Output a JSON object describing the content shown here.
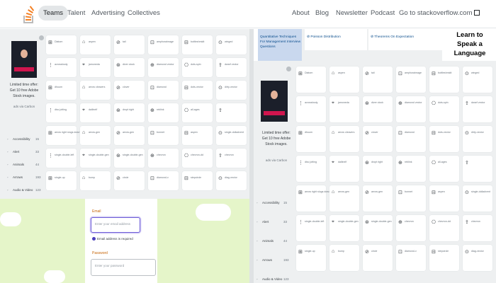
{
  "topbar": {
    "logo": "stackoverflow-logo",
    "nav": [
      "Teams",
      "Talent",
      "Advertising",
      "Collectives"
    ],
    "right_links": [
      "About",
      "Blog",
      "Newsletter",
      "Podcast",
      "Go to stackoverflow.com"
    ]
  },
  "blog": {
    "titles": [
      "Quantitative Techniques For Management Interview Questions",
      "Poisson Distribution",
      "Theorems On Expectation"
    ],
    "ad_big": "Learn to Speak a Language"
  },
  "ad": {
    "headline": "Limited time offer: Get 10 free Adobe Stock images.",
    "author": "ads via Carbon"
  },
  "categories": [
    {
      "label": "Accessibility",
      "count": "15"
    },
    {
      "label": "Alert",
      "count": "33"
    },
    {
      "label": "Animals",
      "count": "44"
    },
    {
      "label": "Arrows",
      "count": "193"
    },
    {
      "label": "Audio & Video",
      "count": "123"
    }
  ],
  "tiles_left": [
    [
      "Diatom",
      "aspen",
      "tail",
      "amphoraimage",
      "bottleshmidt",
      "winged"
    ],
    [
      "acrossbody",
      "jamoneda",
      "diver clock",
      "diamond vector",
      "dots-spin",
      "dwarf vector"
    ],
    [
      "dhuum",
      "arrow cleavers",
      "clover",
      "diamond",
      "dots-vector",
      "dirty-vector"
    ],
    [
      "disc jotting",
      "dailinelf",
      "dropt right",
      "reblink",
      "all-ages",
      ""
    ],
    [
      "arrow right slugs down",
      "arrow-gen",
      "arrow-gen",
      "bonnet",
      "aspen",
      "single-dolladvent"
    ],
    [
      "single-double-left",
      "single-double-gen",
      "single-double-gen",
      "chevron",
      "chevron-dd",
      "chevron"
    ],
    [
      "single-up",
      "bump",
      "circle",
      "diamond-v",
      "stepcircle",
      "diag-vector"
    ]
  ],
  "tiles_right": [
    [
      "Diatom",
      "aspen",
      "tail",
      "amphoraimage",
      "bottleshmidt",
      "winged"
    ],
    [
      "acrossbody",
      "jamoneda",
      "diver clock",
      "diamond vector",
      "dots-spin",
      "dwarf vector"
    ],
    [
      "dhuum",
      "arrow cleavers",
      "clover",
      "diamond",
      "dots-vector",
      "dirty-vector"
    ],
    [
      "disc jotting",
      "dailinelf",
      "dropt right",
      "reblink",
      "all-ages",
      ""
    ],
    [
      "arrow right slugs down",
      "arrow-gen",
      "arrow-gen",
      "bonnet",
      "aspen",
      "single-dolladvent"
    ],
    [
      "single-double-left",
      "single-double-gen",
      "single-double-gen",
      "chevron",
      "chevron-dd",
      "chevron"
    ],
    [
      "single-up",
      "bump",
      "circle",
      "diamond-v",
      "stepcircle",
      "diag-vector"
    ]
  ],
  "form": {
    "email_label": "Email",
    "email_placeholder": "Enter your email address",
    "verified": "Email address is required",
    "password_label": "Password",
    "password_placeholder": "Enter your password"
  }
}
